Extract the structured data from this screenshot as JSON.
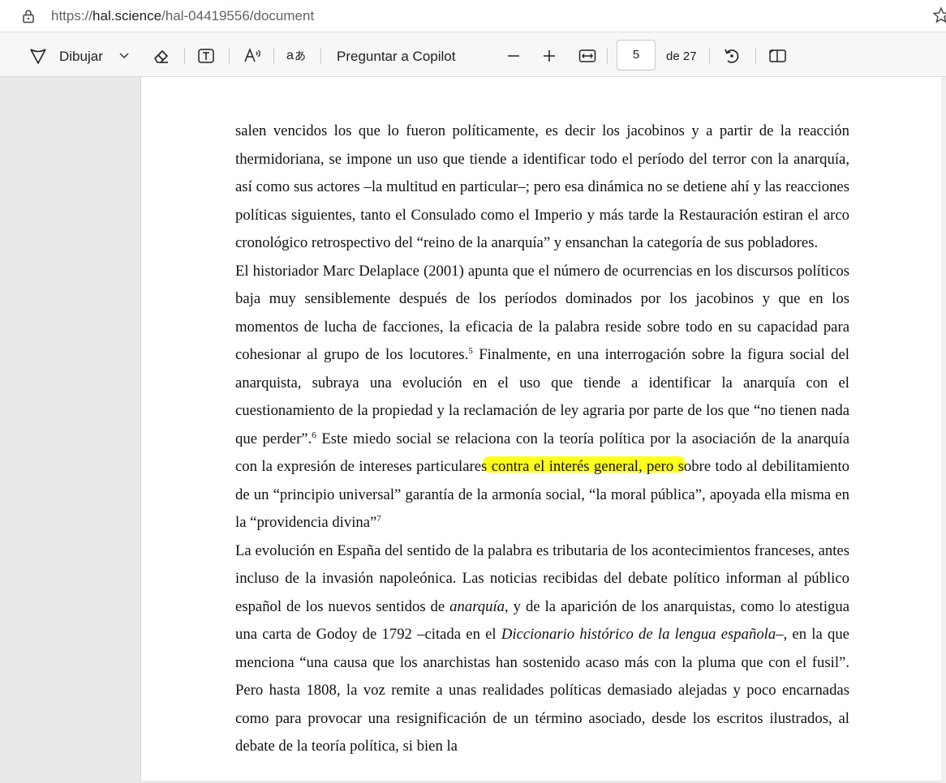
{
  "address_bar": {
    "url_prefix": "https://",
    "url_host": "hal.science",
    "url_path": "/hal-04419556/document"
  },
  "toolbar": {
    "draw_label": "Dibujar",
    "copilot_label": "Preguntar a Copilot",
    "page_number": "5",
    "page_total": "de 27"
  },
  "highlight_color": "#ffff00",
  "document": {
    "p1": "salen vencidos los que lo fueron políticamente, es decir los jacobinos y a partir de la reacción thermidoriana, se impone un uso que tiende a identificar todo el período del terror con la anarquía, así como sus actores –la multitud en particular–; pero esa dinámica no se detiene ahí y las reacciones políticas siguientes, tanto el Consulado como el Imperio y más tarde la Restauración estiran el arco cronológico retrospectivo del “reino de la anarquía” y ensanchan la categoría de sus pobladores.",
    "p2a": "El historiador Marc Delaplace (2001) apunta que el número de ocurrencias en los discursos políticos baja muy sensiblemente después de los períodos dominados por los jacobinos y que en los momentos de lucha de facciones, la eficacia de la palabra reside sobre todo en su capacidad para cohesionar al grupo de los locutores.",
    "fn5": "5",
    "p2b": " Finalmente, en una interrogación sobre la figura social del anarquista, subraya una evolución en el uso que tiende a identificar la anarquía con el cuestionamiento de la propiedad y la reclamación de ley agraria por parte de los que “no tienen nada que perder”.",
    "fn6": "6",
    "p2c": " Este miedo social se relaciona con la teoría política por la asociación de la anarquía con la expresión de intereses particulares contra el interés general, pero sobre todo al debilitamiento de un “principio universal” garantía de la armonía social, “la moral pública”, apoyada ella misma en la “providencia divina”",
    "fn7": "7",
    "p3a": "La evolución en España del sentido de la palabra es tributaria de los acontecimientos franceses, antes incluso de la invasión napoleónica. Las noticias recibidas del debate político informan al público español de los nuevos sentidos de ",
    "p3b": "anarquía",
    "p3c": ", y de la aparición de los anarquistas, como lo atestigua una carta de Godoy de 1792 –citada en el ",
    "p3d": "Diccionario histórico de la lengua española",
    "p3e": "–, en la que menciona “una causa que los anarchistas han sostenido acaso más con la pluma que con el fusil”. Pero hasta 1808, la voz remite a unas realidades políticas demasiado alejadas y poco encarnadas como para provocar una resignificación de un término asociado, desde los escritos ilustrados, al debate de la teoría política, si bien la"
  }
}
